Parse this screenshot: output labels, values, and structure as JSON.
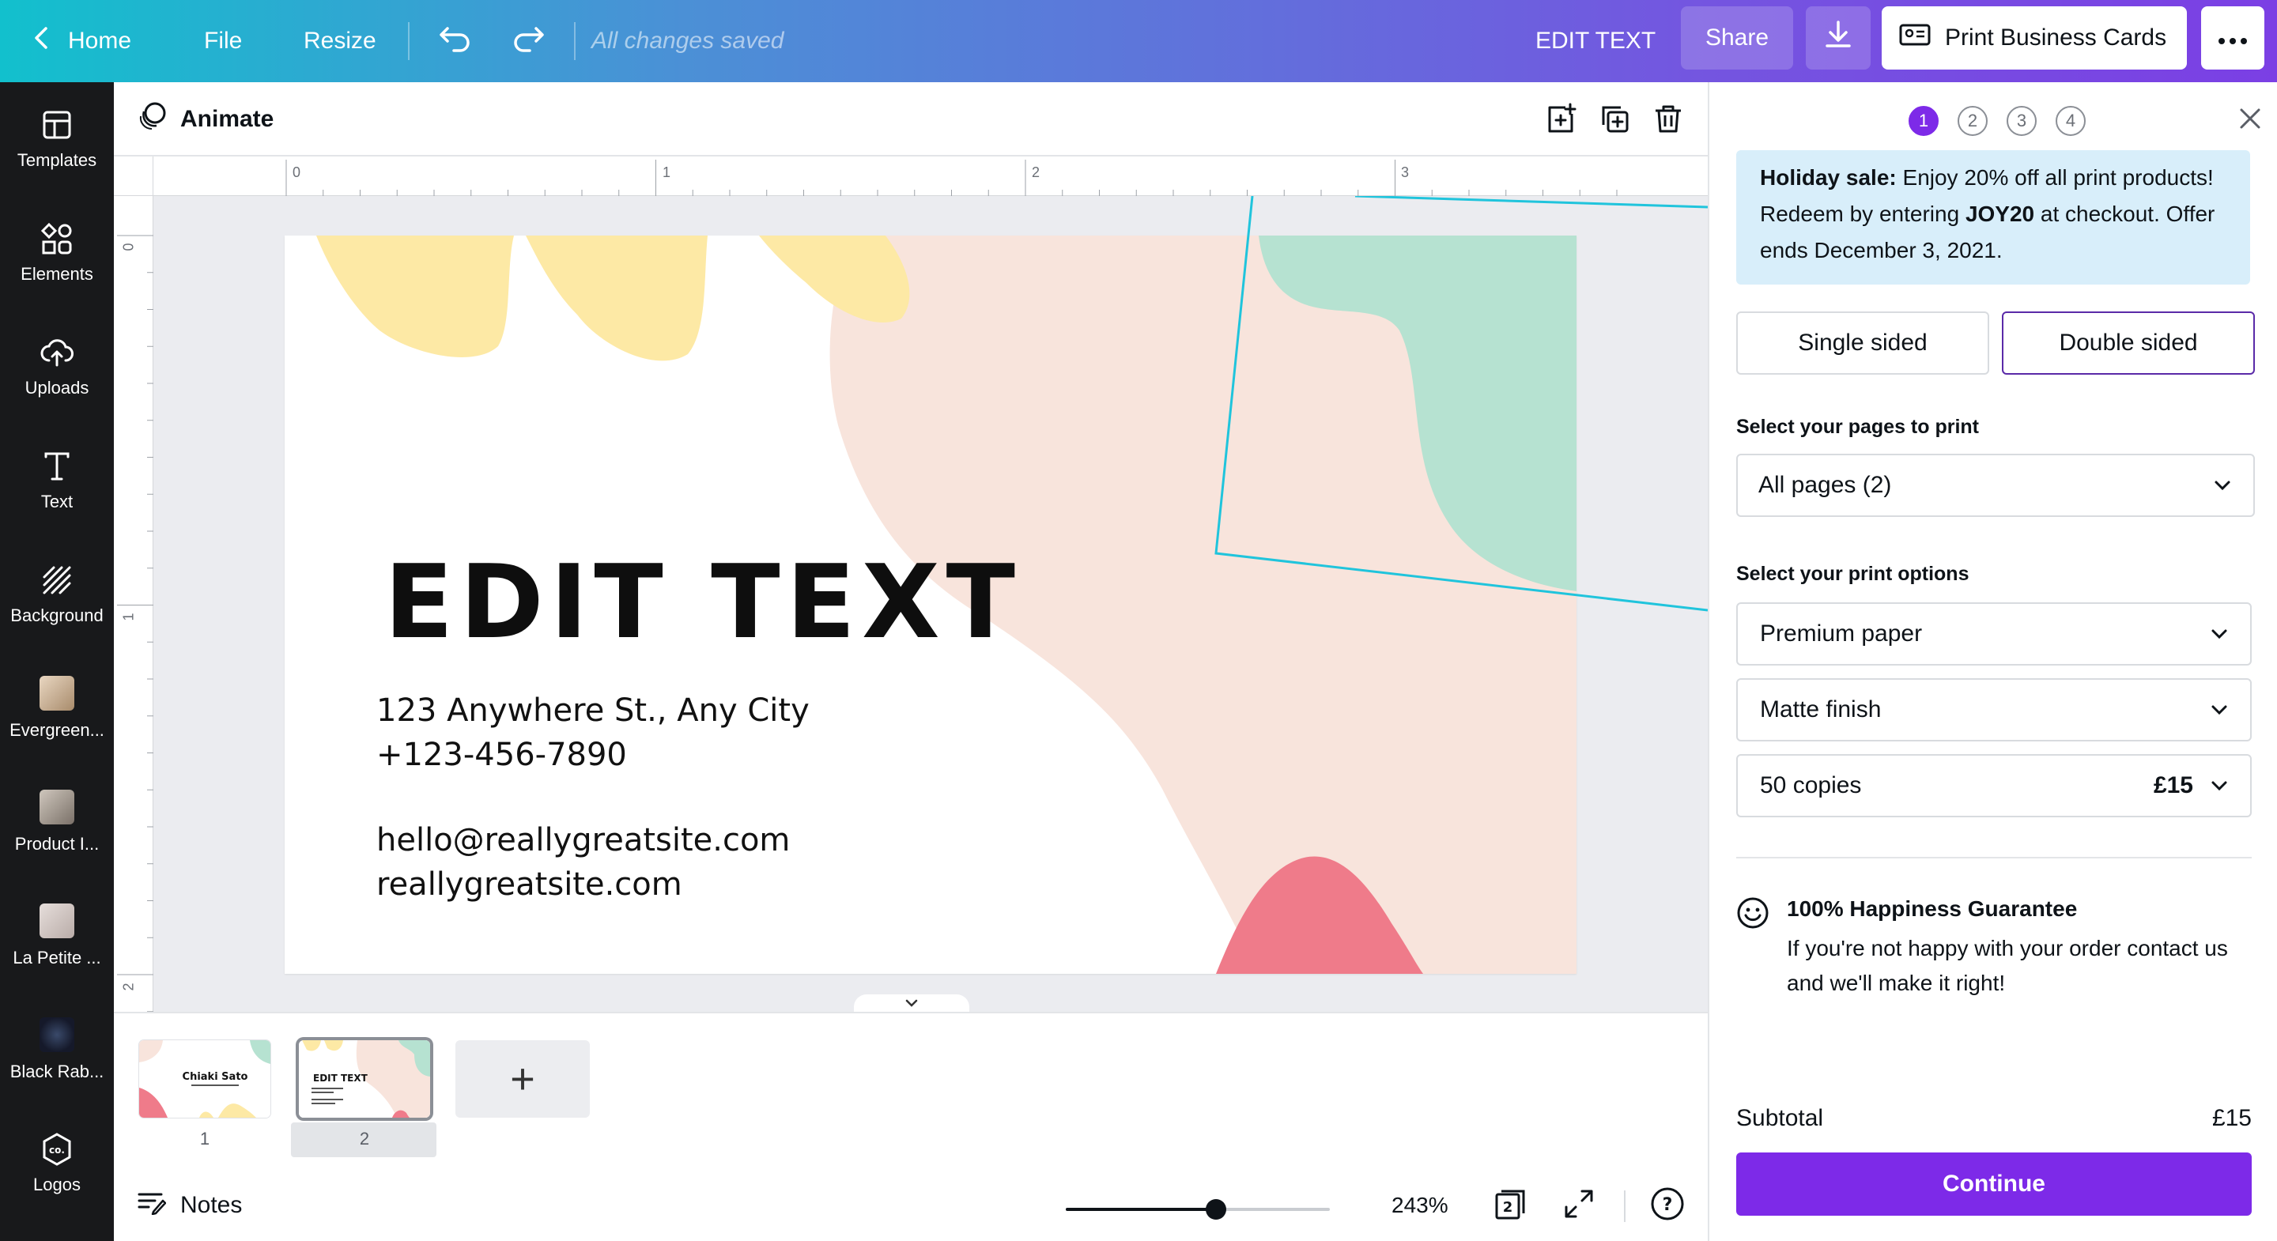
{
  "topbar": {
    "home": "Home",
    "file": "File",
    "resize": "Resize",
    "saved_status": "All changes saved",
    "doc_title": "EDIT TEXT",
    "share": "Share",
    "print": "Print Business Cards",
    "gradient_start": "#12c0cd",
    "gradient_end": "#7b3fe4"
  },
  "sidebar": {
    "items": [
      {
        "label": "Templates",
        "icon": "templates-icon"
      },
      {
        "label": "Elements",
        "icon": "elements-icon"
      },
      {
        "label": "Uploads",
        "icon": "upload-cloud-icon"
      },
      {
        "label": "Text",
        "icon": "text-icon"
      },
      {
        "label": "Background",
        "icon": "background-icon"
      },
      {
        "label": "Evergreen...",
        "icon": "evergreen-thumb"
      },
      {
        "label": "Product I...",
        "icon": "product-thumb"
      },
      {
        "label": "La Petite ...",
        "icon": "la-petite-thumb"
      },
      {
        "label": "Black Rab...",
        "icon": "black-rabbit-thumb"
      },
      {
        "label": "Logos",
        "icon": "logos-icon"
      }
    ]
  },
  "editor": {
    "animate": "Animate"
  },
  "ruler": {
    "top": [
      "0",
      "1",
      "2",
      "3"
    ],
    "left": [
      "0",
      "1",
      "2"
    ]
  },
  "card": {
    "title": "EDIT TEXT",
    "address": "123 Anywhere St., Any City",
    "phone": "+123-456-7890",
    "email": "hello@reallygreatsite.com",
    "website": "reallygreatsite.com",
    "colors": {
      "yellow": "#fde9a5",
      "peach": "#f8e4dc",
      "mint": "#b6e2d1",
      "pink": "#ef7b8a",
      "frame": "#20c4dc"
    }
  },
  "pages": {
    "thumbs": [
      {
        "number": "1",
        "text": "Chiaki Sato"
      },
      {
        "number": "2",
        "text": "EDIT TEXT"
      }
    ],
    "add": "+"
  },
  "bottom": {
    "notes": "Notes",
    "zoom": "243%",
    "zoom_level": 0.57,
    "page_count": "2",
    "help": "?"
  },
  "panel": {
    "steps": [
      "1",
      "2",
      "3",
      "4"
    ],
    "promo_bold": "Holiday sale:",
    "promo_text1": " Enjoy 20% off all print products! Redeem by entering ",
    "promo_code": "JOY20",
    "promo_text2": " at checkout. Offer ends December 3, 2021.",
    "single_sided": "Single sided",
    "double_sided": "Double sided",
    "pages_label": "Select your pages to print",
    "pages_value": "All pages (2)",
    "options_label": "Select your print options",
    "paper": "Premium paper",
    "finish": "Matte finish",
    "copies": "50 copies",
    "copies_price": "£15",
    "guarantee_title": "100% Happiness Guarantee",
    "guarantee_body": "If you're not happy with your order contact us and we'll make it right!",
    "subtotal_label": "Subtotal",
    "subtotal_value": "£15",
    "continue": "Continue",
    "accent": "#7d2ae8"
  }
}
